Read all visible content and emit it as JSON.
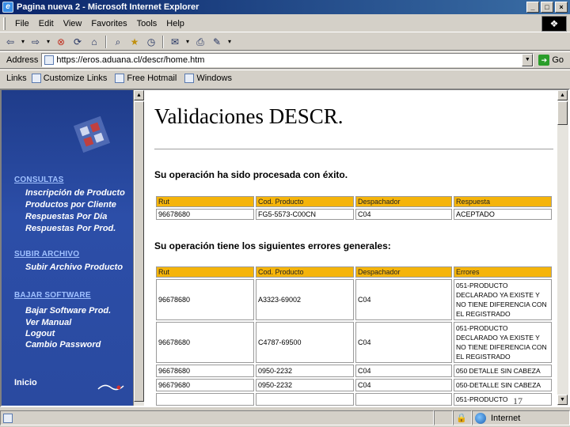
{
  "window": {
    "title": "Pagina nueva 2 - Microsoft Internet Explorer",
    "min_label": "_",
    "max_label": "□",
    "close_label": "×"
  },
  "menu": {
    "items": [
      "File",
      "Edit",
      "View",
      "Favorites",
      "Tools",
      "Help"
    ]
  },
  "toolbar": {
    "icons": [
      "back-icon",
      "forward-icon",
      "stop-icon",
      "refresh-icon",
      "home-icon",
      "search-icon",
      "favorites-icon",
      "history-icon",
      "mail-icon",
      "print-icon",
      "edit-icon"
    ]
  },
  "address": {
    "label": "Address",
    "url": "https://eros.aduana.cl/descr/home.htm",
    "go_label": "Go"
  },
  "links": {
    "label": "Links",
    "items": [
      "Customize Links",
      "Free Hotmail",
      "Windows"
    ]
  },
  "sidebar": {
    "sections": [
      {
        "title": "CONSULTAS",
        "items": [
          "Inscripción de Producto",
          "Productos por Cliente",
          "Respuestas Por Día",
          "Respuestas Por Prod."
        ]
      },
      {
        "title": "SUBIR ARCHIVO",
        "items": [
          "Subir Archivo Producto"
        ]
      },
      {
        "title": "BAJAR SOFTWARE",
        "items": [
          "Bajar Software Prod.",
          "Ver Manual",
          "Logout",
          "Cambio Password"
        ]
      }
    ],
    "inicio": "Inicio"
  },
  "main": {
    "title": "Validaciones DESCR.",
    "success_msg": "Su operación ha sido procesada con éxito.",
    "table1": {
      "headers": [
        "Rut",
        "Cod. Producto",
        "Despachador",
        "Respuesta"
      ],
      "rows": [
        [
          "96678680",
          "FG5-5573-C00CN",
          "C04",
          "ACEPTADO"
        ]
      ]
    },
    "errors_msg": "Su operación tiene los siguientes errores generales:",
    "table2": {
      "headers": [
        "Rut",
        "Cod. Producto",
        "Despachador",
        "Errores"
      ],
      "rows": [
        [
          "96678680",
          "A3323-69002",
          "C04",
          "051-PRODUCTO DECLARADO YA EXISTE Y NO TIENE DIFERENCIA CON EL REGISTRADO"
        ],
        [
          "96678680",
          "C4787-69500",
          "C04",
          "051-PRODUCTO DECLARADO YA EXISTE Y NO TIENE DIFERENCIA CON EL REGISTRADO"
        ],
        [
          "96678680",
          "0950-2232",
          "C04",
          "050 DETALLE SIN CABEZA"
        ],
        [
          "96679680",
          "0950-2232",
          "C04",
          "050-DETALLE SIN CABEZA"
        ],
        [
          "",
          "",
          "",
          "051-PRODUCTO"
        ]
      ]
    },
    "page_number": "17"
  },
  "status": {
    "zone": "Internet"
  }
}
